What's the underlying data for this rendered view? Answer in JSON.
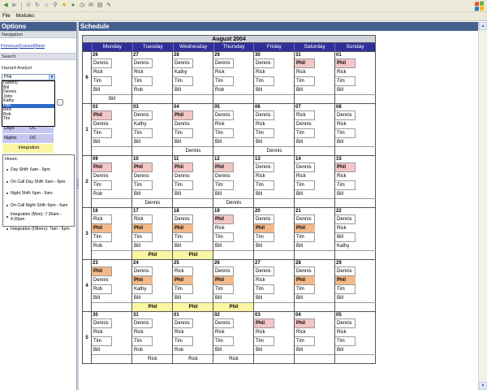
{
  "menu": {
    "file": "File",
    "modules": "Modules"
  },
  "toolbar": {
    "icons": [
      "back-icon",
      "forward-icon",
      "stop-icon",
      "refresh-icon",
      "home-icon",
      "search-icon",
      "favorites-icon",
      "media-icon",
      "history-icon",
      "mail-icon",
      "print-icon",
      "edit-icon"
    ]
  },
  "options": {
    "title": "Options",
    "navigation": {
      "title": "Navigation",
      "previous": "Previous",
      "current": "Current",
      "next": "Next",
      "sep": "|"
    },
    "search": {
      "title": "Search",
      "label": "Hazard Analyst",
      "selected": "Phil",
      "options": [
        "(Select)",
        "Bill",
        "Dennis",
        "John",
        "Kathy",
        "Phil",
        "Rick",
        "Rob",
        "Tim"
      ]
    },
    "shifts": {
      "rows": [
        {
          "label": "Days",
          "value": "OC",
          "color": "#c5c7f0"
        },
        {
          "label": "Nights",
          "value": "OC",
          "color": "#c5c7f0"
        },
        {
          "label": "Integration",
          "value": "",
          "color": "#fbf5a3"
        }
      ]
    },
    "hours": {
      "title": "Hours:",
      "items": [
        "Day Shift: 6am - 6pm",
        "On Call Day Shift: 6am - 6pm",
        "Night Shift: 6pm - 6am",
        "On Call Night Shift: 6pm - 6am",
        "Integration (Mon): 7:30am - 4:30pm",
        "Integration (Others): 7am - 5pm"
      ]
    }
  },
  "schedule": {
    "title": "Schedule",
    "month": "August 2004",
    "days": [
      "Monday",
      "Tuesday",
      "Wednesday",
      "Thursday",
      "Friday",
      "Saturday",
      "Sunday"
    ],
    "weeks": [
      {
        "number": "6",
        "days": [
          {
            "date": "26",
            "slots": [
              "Dennis",
              "Rick",
              "Tim",
              "Bill"
            ],
            "integ": "Bill"
          },
          {
            "date": "27",
            "slots": [
              "Dennis",
              "Rick",
              "Tim",
              "Rob"
            ],
            "integ": ""
          },
          {
            "date": "28",
            "slots": [
              "Dennis",
              "Kathy",
              "Tim",
              "Bill"
            ],
            "integ": ""
          },
          {
            "date": "29",
            "slots": [
              "Dennis",
              "Rick",
              "Tim",
              "Rob"
            ],
            "integ": ""
          },
          {
            "date": "30",
            "slots": [
              "Dennis",
              "Rick",
              "Tim",
              "Bill"
            ],
            "integ": ""
          },
          {
            "date": "31",
            "slots": [
              "Phil",
              "Rick",
              "Tim",
              "Bill"
            ],
            "integ": "",
            "hl": [
              0,
              "pink"
            ]
          },
          {
            "date": "01",
            "slots": [
              "Phil",
              "Rick",
              "Tim",
              "Bill"
            ],
            "integ": "",
            "hl": [
              0,
              "pink"
            ]
          }
        ]
      },
      {
        "number": "1",
        "days": [
          {
            "date": "02",
            "slots": [
              "Phil",
              "Dennis",
              "Tim",
              "Bill"
            ],
            "integ": "",
            "hl": [
              0,
              "pink"
            ]
          },
          {
            "date": "03",
            "slots": [
              "Dennis",
              "Kathy",
              "Tim",
              "Bill"
            ],
            "integ": ""
          },
          {
            "date": "04",
            "slots": [
              "Phil",
              "Dennis",
              "Tim",
              "Bill"
            ],
            "integ": "Dennis",
            "hl": [
              0,
              "pink"
            ]
          },
          {
            "date": "05",
            "slots": [
              "Dennis",
              "Rick",
              "Tim",
              "Bill"
            ],
            "integ": ""
          },
          {
            "date": "06",
            "slots": [
              "Dennis",
              "Rick",
              "Tim",
              "Bill"
            ],
            "integ": "Dennis"
          },
          {
            "date": "07",
            "slots": [
              "Rick",
              "Dennis",
              "Tim",
              "Bill"
            ],
            "integ": ""
          },
          {
            "date": "08",
            "slots": [
              "Dennis",
              "Rick",
              "Tim",
              "Bill"
            ],
            "integ": ""
          }
        ]
      },
      {
        "number": "2",
        "days": [
          {
            "date": "09",
            "slots": [
              "Phil",
              "Dennis",
              "Tim",
              "Rob"
            ],
            "integ": "",
            "hl": [
              0,
              "pink"
            ]
          },
          {
            "date": "10",
            "slots": [
              "Phil",
              "Dennis",
              "Tim",
              "Bill"
            ],
            "integ": "Dennis",
            "hl": [
              0,
              "pink"
            ]
          },
          {
            "date": "11",
            "slots": [
              "Phil",
              "Dennis",
              "Tim",
              "Bill"
            ],
            "integ": "",
            "hl": [
              0,
              "pink"
            ]
          },
          {
            "date": "12",
            "slots": [
              "Phil",
              "Dennis",
              "Tim",
              "Bill"
            ],
            "integ": "Dennis",
            "hl": [
              0,
              "pink"
            ]
          },
          {
            "date": "13",
            "slots": [
              "Dennis",
              "Rick",
              "Tim",
              "Bill"
            ],
            "integ": ""
          },
          {
            "date": "14",
            "slots": [
              "Dennis",
              "Rick",
              "Tim",
              "Bill"
            ],
            "integ": ""
          },
          {
            "date": "15",
            "slots": [
              "Phil",
              "Rick",
              "Tim",
              "Bill"
            ],
            "integ": "",
            "hl": [
              0,
              "pink"
            ]
          }
        ]
      },
      {
        "number": "3",
        "days": [
          {
            "date": "16",
            "slots": [
              "Rick",
              "Phil",
              "Tim",
              "Rob"
            ],
            "integ": "",
            "hl": [
              1,
              "orange"
            ]
          },
          {
            "date": "17",
            "slots": [
              "Rick",
              "Phil",
              "Tim",
              "Bill"
            ],
            "integ": "Phil",
            "integHl": true,
            "hl": [
              1,
              "orange"
            ]
          },
          {
            "date": "18",
            "slots": [
              "Dennis",
              "Phil",
              "Tim",
              "Bill"
            ],
            "integ": "Phil",
            "integHl": true,
            "hl": [
              1,
              "orange"
            ]
          },
          {
            "date": "19",
            "slots": [
              "Phil",
              "Rick",
              "Tim",
              "Bill"
            ],
            "integ": "",
            "hl": [
              0,
              "pink"
            ]
          },
          {
            "date": "20",
            "slots": [
              "Dennis",
              "Phil",
              "Tim",
              "Bill"
            ],
            "integ": "",
            "hl": [
              1,
              "orange"
            ]
          },
          {
            "date": "21",
            "slots": [
              "Dennis",
              "Phil",
              "Tim",
              "Bill"
            ],
            "integ": "",
            "hl": [
              1,
              "orange"
            ]
          },
          {
            "date": "22",
            "slots": [
              "Dennis",
              "Rick",
              "Bill",
              "Kathy"
            ],
            "integ": ""
          }
        ]
      },
      {
        "number": "4",
        "days": [
          {
            "date": "23",
            "slots": [
              "Phil",
              "Dennis",
              "Rob",
              "Bill"
            ],
            "integ": "",
            "hl": [
              0,
              "orange"
            ]
          },
          {
            "date": "24",
            "slots": [
              "Dennis",
              "Phil",
              "Kathy",
              "Bill"
            ],
            "integ": "Phil",
            "integHl": true,
            "hl": [
              1,
              "orange"
            ]
          },
          {
            "date": "25",
            "slots": [
              "Rick",
              "Phil",
              "Tim",
              "Bill"
            ],
            "integ": "Phil",
            "integHl": true,
            "hl": [
              1,
              "orange"
            ]
          },
          {
            "date": "26",
            "slots": [
              "Dennis",
              "Phil",
              "Tim",
              "Bill"
            ],
            "integ": "Phil",
            "integHl": true,
            "hl": [
              1,
              "orange"
            ]
          },
          {
            "date": "27",
            "slots": [
              "Dennis",
              "Rick",
              "Tim",
              "Bill"
            ],
            "integ": ""
          },
          {
            "date": "28",
            "slots": [
              "Dennis",
              "Phil",
              "Tim",
              "Bill"
            ],
            "integ": "",
            "hl": [
              1,
              "orange"
            ]
          },
          {
            "date": "29",
            "slots": [
              "Dennis",
              "Phil",
              "Tim",
              "Bill"
            ],
            "integ": "",
            "hl": [
              1,
              "orange"
            ]
          }
        ]
      },
      {
        "number": "5",
        "days": [
          {
            "date": "30",
            "slots": [
              "Dennis",
              "Rick",
              "Tim",
              "Bill"
            ],
            "integ": ""
          },
          {
            "date": "31",
            "slots": [
              "Dennis",
              "Rick",
              "Tim",
              "Rob"
            ],
            "integ": "Rick"
          },
          {
            "date": "01",
            "slots": [
              "Dennis",
              "Rick",
              "Tim",
              "Rob"
            ],
            "integ": "Rick"
          },
          {
            "date": "02",
            "slots": [
              "Dennis",
              "Rick",
              "Tim",
              "Bill"
            ],
            "integ": "Rick"
          },
          {
            "date": "03",
            "slots": [
              "Phil",
              "Rick",
              "Tim",
              "Bill"
            ],
            "integ": "",
            "hl": [
              0,
              "pink"
            ]
          },
          {
            "date": "04",
            "slots": [
              "Phil",
              "Rick",
              "Tim",
              "Bill"
            ],
            "integ": "",
            "hl": [
              0,
              "pink"
            ]
          },
          {
            "date": "05",
            "slots": [
              "Dennis",
              "Rick",
              "Tim",
              "Bill"
            ],
            "integ": ""
          }
        ]
      }
    ]
  },
  "colors": {
    "panel_header": "#44608f",
    "day_header": "#2f2f9a",
    "highlight_pink": "#f4c6c6",
    "highlight_orange": "#f2b98a",
    "integration_yellow": "#fbf5a3",
    "oncall_lavender": "#c5c7f0"
  }
}
